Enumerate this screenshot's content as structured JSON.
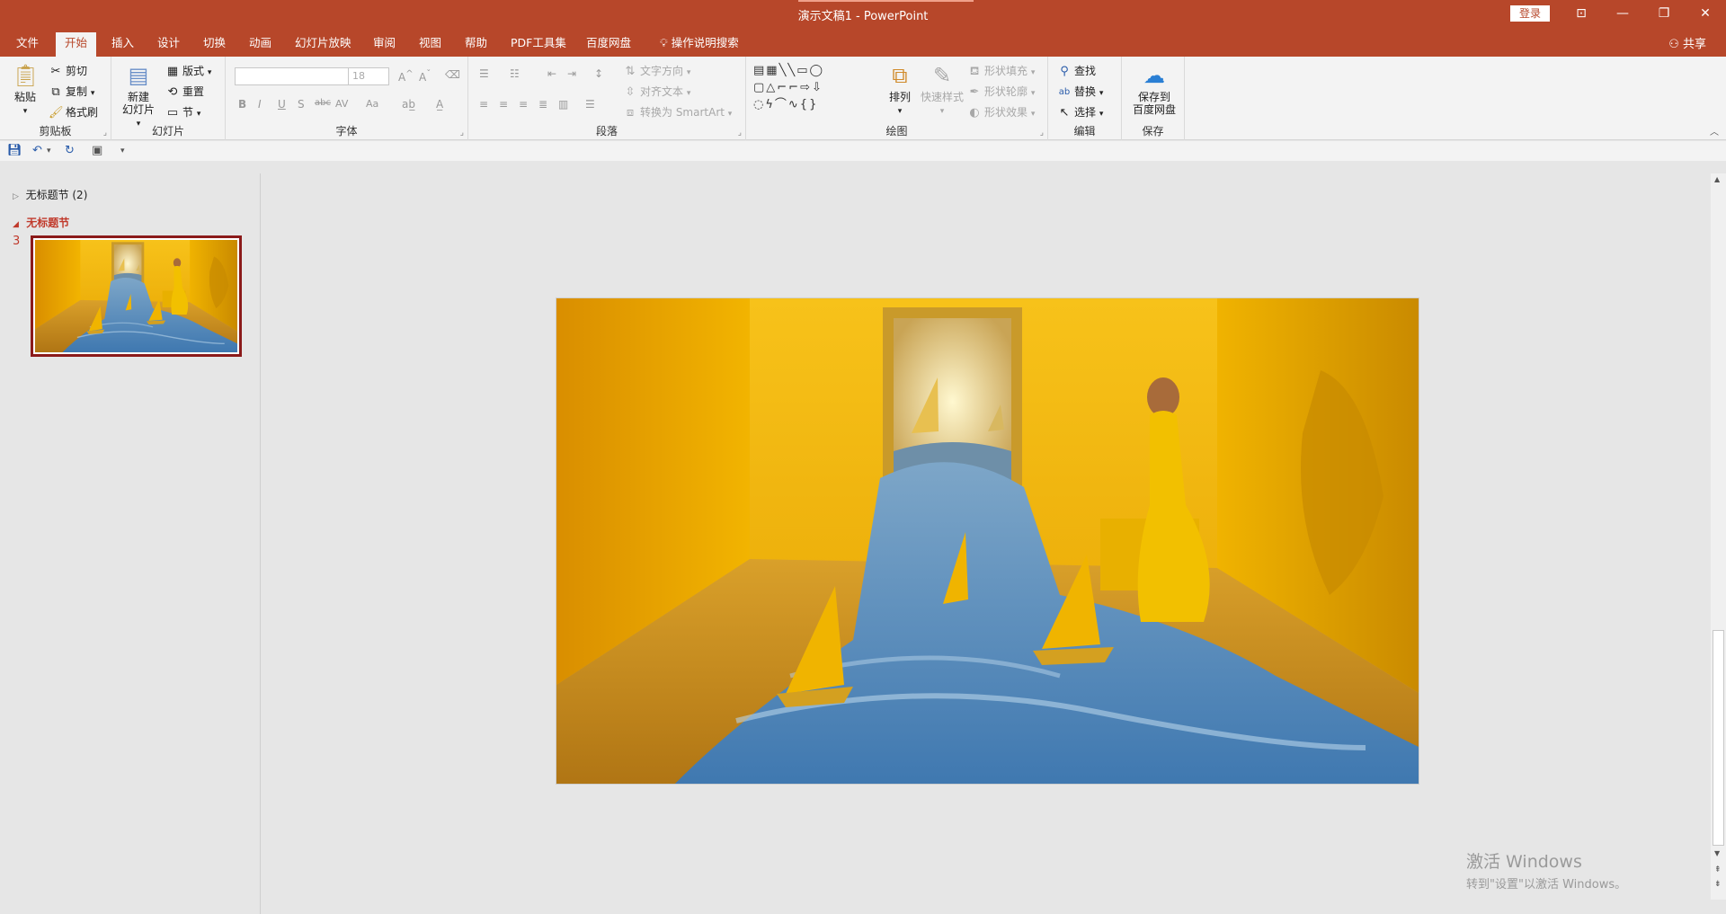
{
  "window": {
    "title": "演示文稿1  -  PowerPoint",
    "login": "登录",
    "controls": {
      "ribbon_options": "⊡",
      "minimize": "—",
      "restore": "❐",
      "close": "✕"
    }
  },
  "tabs": [
    "文件",
    "开始",
    "插入",
    "设计",
    "切换",
    "动画",
    "幻灯片放映",
    "审阅",
    "视图",
    "帮助",
    "PDF工具集",
    "百度网盘",
    "操作说明搜索"
  ],
  "active_tab": "开始",
  "share": "共享",
  "ribbon": {
    "clipboard": {
      "paste": "粘贴",
      "cut": "剪切",
      "copy": "复制",
      "format_painter": "格式刷",
      "label": "剪贴板"
    },
    "slides": {
      "new_slide_line1": "新建",
      "new_slide_line2": "幻灯片",
      "layout": "版式",
      "reset": "重置",
      "section": "节",
      "label": "幻灯片"
    },
    "font": {
      "font_name": "",
      "font_size": "18",
      "bold": "B",
      "italic": "I",
      "underline": "U",
      "shadow": "S",
      "strike": "abc",
      "spacing": "AV",
      "case": "Aa",
      "label": "字体"
    },
    "paragraph": {
      "text_direction": "文字方向",
      "align_text": "对齐文本",
      "smartart": "转换为 SmartArt",
      "label": "段落"
    },
    "drawing": {
      "arrange": "排列",
      "quick_styles": "快速样式",
      "shape_fill": "形状填充",
      "shape_outline": "形状轮廓",
      "shape_effects": "形状效果",
      "label": "绘图"
    },
    "editing": {
      "find": "查找",
      "replace": "替换",
      "select": "选择",
      "label": "编辑"
    },
    "save": {
      "line1": "保存到",
      "line2": "百度网盘",
      "label": "保存"
    }
  },
  "slides_pane": {
    "sections": [
      {
        "name": "无标题节 (2)",
        "expanded": false
      },
      {
        "name": "无标题节",
        "expanded": true
      }
    ],
    "selected_slide_number": "3"
  },
  "watermark": {
    "line1": "激活 Windows",
    "line2": "转到\"设置\"以激活 Windows。"
  },
  "colors": {
    "accent": "#b7472a",
    "ribbon_bg": "#f3f3f3",
    "canvas_bg": "#e6e6e6"
  }
}
